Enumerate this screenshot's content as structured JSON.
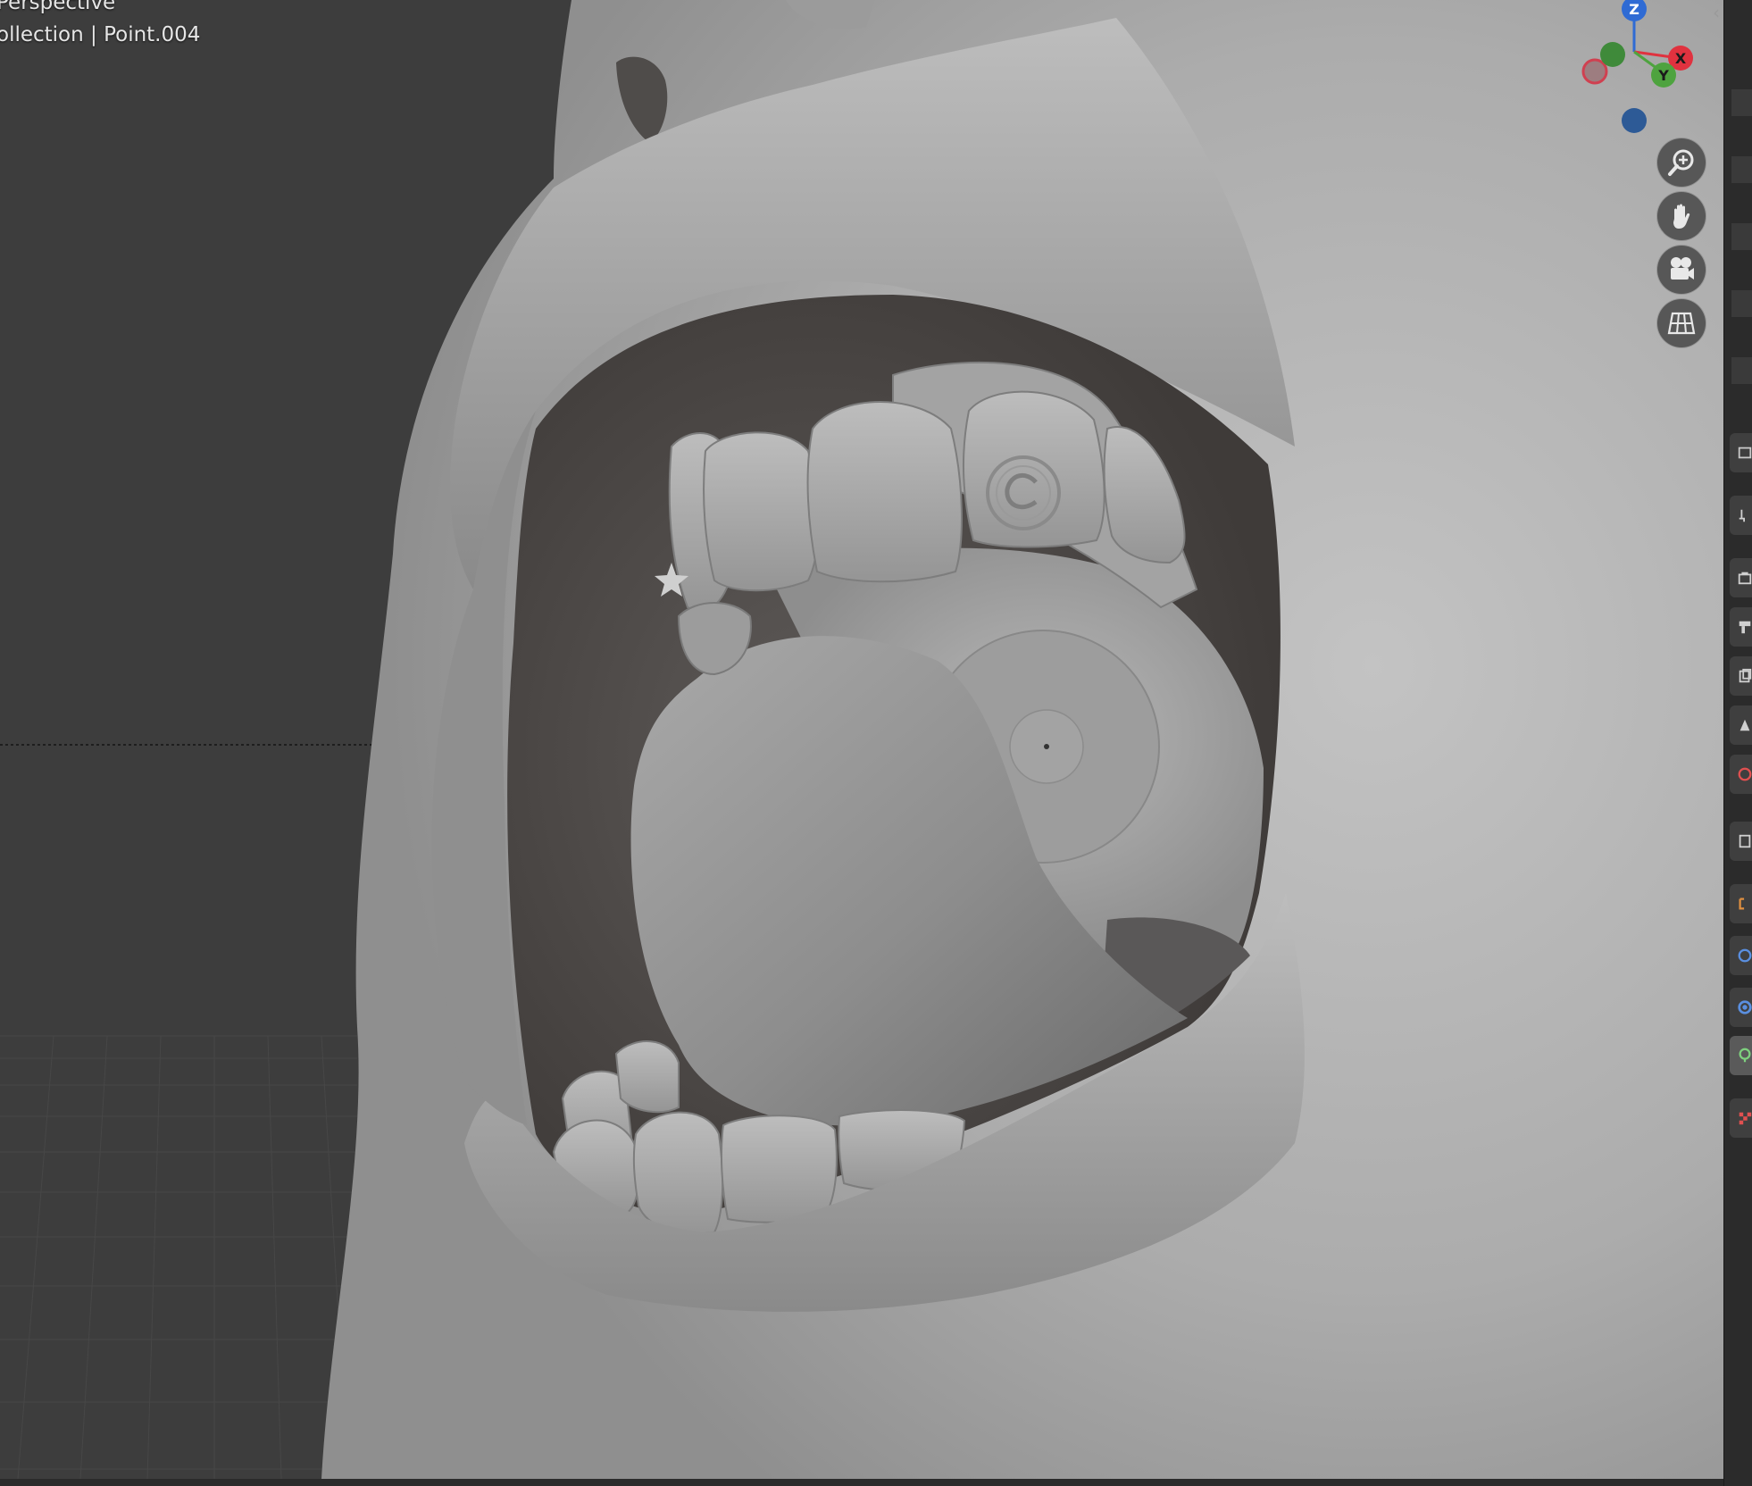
{
  "viewport": {
    "view_mode": "Perspective",
    "object_info": "ollection | Point.004"
  },
  "gizmo": {
    "axes": [
      {
        "name": "Z",
        "color": "#2f6bd4"
      },
      {
        "name": "X",
        "color": "#e0323f"
      },
      {
        "name": "Y",
        "color": "#4ea33f"
      }
    ]
  },
  "nav_buttons": [
    {
      "icon": "zoom-icon"
    },
    {
      "icon": "hand-pan-icon"
    },
    {
      "icon": "camera-view-icon"
    },
    {
      "icon": "grid-ortho-icon"
    }
  ],
  "properties_tabs": [
    {
      "icon": "tool-icon"
    },
    {
      "icon": "render-icon"
    },
    {
      "icon": "output-icon"
    },
    {
      "icon": "view-layer-icon"
    },
    {
      "icon": "scene-icon"
    },
    {
      "icon": "world-icon"
    },
    {
      "icon": "collection-icon"
    },
    {
      "icon": "object-icon"
    },
    {
      "icon": "physics-icon"
    },
    {
      "icon": "constraints-icon"
    },
    {
      "icon": "object-data-light-icon"
    },
    {
      "icon": "texture-icon"
    }
  ],
  "colors": {
    "viewport_bg": "#3d3d3d",
    "mesh": "#a9a9a9",
    "panel_bg": "#2b2b2b"
  }
}
